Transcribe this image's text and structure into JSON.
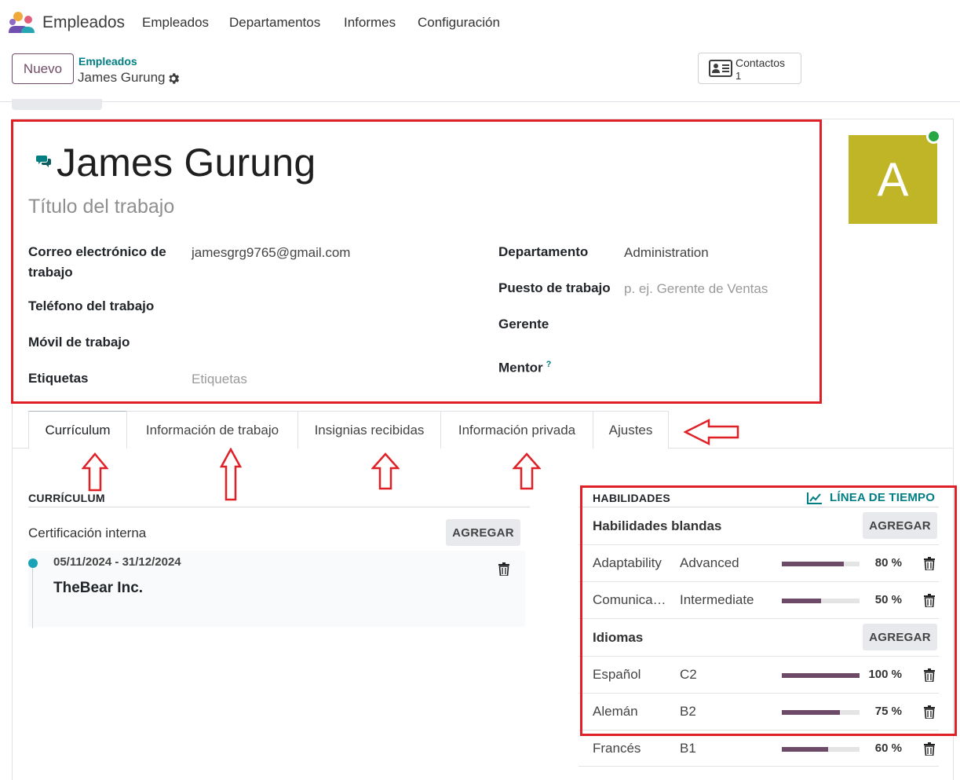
{
  "app": {
    "name": "Empleados",
    "menu": [
      "Empleados",
      "Departamentos",
      "Informes",
      "Configuración"
    ]
  },
  "control": {
    "new_label": "Nuevo",
    "breadcrumb_parent": "Empleados",
    "breadcrumb_current": "James Gurung",
    "contacts_label": "Contactos",
    "contacts_count": "1"
  },
  "employee": {
    "name": "James Gurung",
    "job_title_placeholder": "Título del trabajo",
    "avatar_letter": "A",
    "avatar_color": "#c0b427",
    "fields_left": [
      {
        "label": "Correo electrónico de trabajo",
        "value": "jamesgrg9765@gmail.com"
      },
      {
        "label": "Teléfono del trabajo",
        "value": ""
      },
      {
        "label": "Móvil de trabajo",
        "value": ""
      },
      {
        "label": "Etiquetas",
        "placeholder": "Etiquetas"
      }
    ],
    "fields_right": [
      {
        "label": "Departamento",
        "value": "Administration"
      },
      {
        "label": "Puesto de trabajo",
        "placeholder": "p. ej. Gerente de Ventas"
      },
      {
        "label": "Gerente",
        "value": ""
      },
      {
        "label": "Mentor",
        "help": "?"
      }
    ]
  },
  "tabs": [
    "Currículum",
    "Información de trabajo",
    "Insignias recibidas",
    "Información privada",
    "Ajustes"
  ],
  "resume": {
    "section_title": "CURRÍCULUM",
    "group_title": "Certificación interna",
    "add_label": "AGREGAR",
    "entries": [
      {
        "dates": "05/11/2024 - 31/12/2024",
        "name": "TheBear Inc."
      }
    ]
  },
  "skills": {
    "section_title": "HABILIDADES",
    "timeline_label": "LÍNEA DE TIEMPO",
    "groups": [
      {
        "title": "Habilidades blandas",
        "add_label": "AGREGAR",
        "items": [
          {
            "name": "Adaptability",
            "level": "Advanced",
            "progress": 80,
            "progress_label": "80 %"
          },
          {
            "name": "Comunicación",
            "level": "Intermediate",
            "progress": 50,
            "progress_label": "50 %"
          }
        ]
      },
      {
        "title": "Idiomas",
        "add_label": "AGREGAR",
        "items": [
          {
            "name": "Español",
            "level": "C2",
            "progress": 100,
            "progress_label": "100 %"
          },
          {
            "name": "Alemán",
            "level": "B2",
            "progress": 75,
            "progress_label": "75 %"
          },
          {
            "name": "Francés",
            "level": "B1",
            "progress": 60,
            "progress_label": "60 %"
          }
        ]
      }
    ]
  },
  "colors": {
    "accent": "#714b67",
    "link": "#017e84",
    "progress": "#6c4a68",
    "annotation": "#e02027"
  }
}
